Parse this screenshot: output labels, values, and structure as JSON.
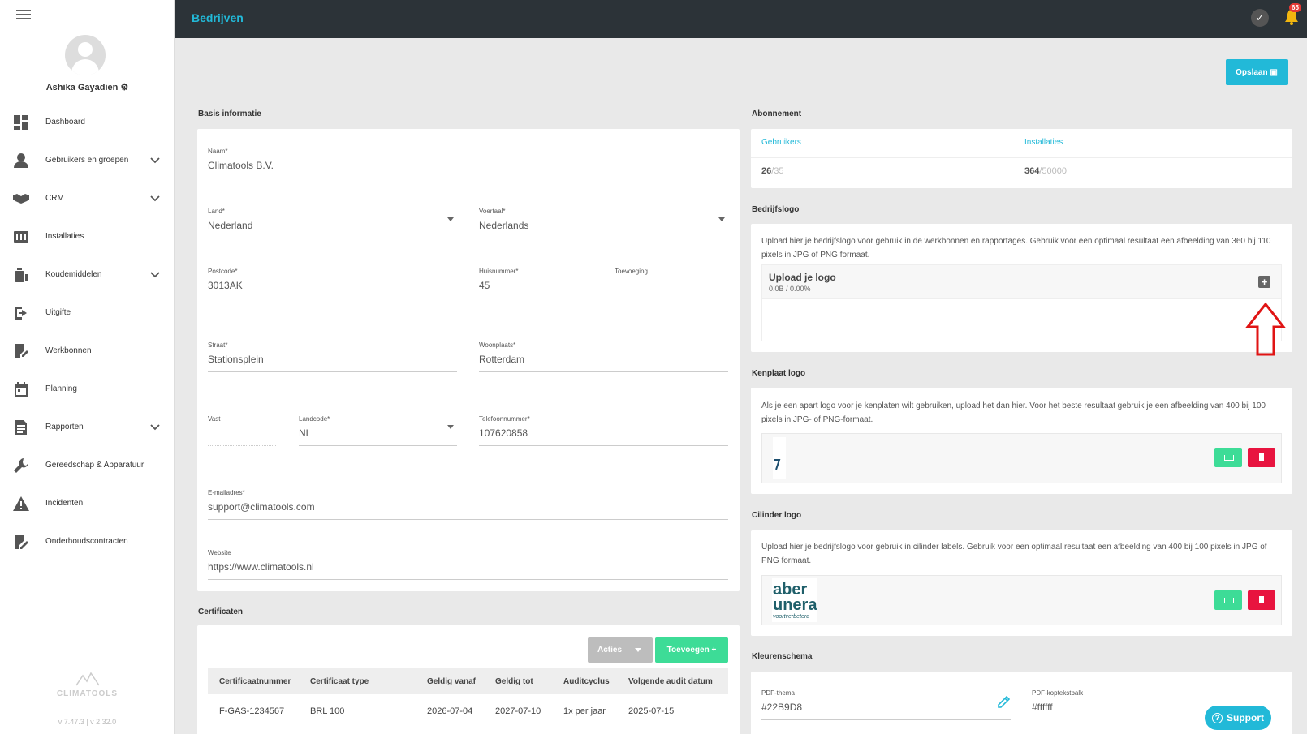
{
  "app": {
    "title": "Bedrijven",
    "notification_count": "65"
  },
  "user": {
    "name": "Ashika Gayadien"
  },
  "sidebar": {
    "items": [
      {
        "label": "Dashboard"
      },
      {
        "label": "Gebruikers en groepen"
      },
      {
        "label": "CRM"
      },
      {
        "label": "Installaties"
      },
      {
        "label": "Koudemiddelen"
      },
      {
        "label": "Uitgifte"
      },
      {
        "label": "Werkbonnen"
      },
      {
        "label": "Planning"
      },
      {
        "label": "Rapporten"
      },
      {
        "label": "Gereedschap & Apparatuur"
      },
      {
        "label": "Incidenten"
      },
      {
        "label": "Onderhoudscontracten"
      }
    ],
    "brand": "CLIMATOOLS",
    "version": "v 7.47.3  | v 2.32.0"
  },
  "toolbar": {
    "save_label": "Opslaan"
  },
  "basis": {
    "title": "Basis informatie",
    "naam_label": "Naam*",
    "naam": "Climatools B.V.",
    "land_label": "Land*",
    "land": "Nederland",
    "voertaal_label": "Voertaal*",
    "voertaal": "Nederlands",
    "postcode_label": "Postcode*",
    "postcode": "3013AK",
    "huisnummer_label": "Huisnummer*",
    "huisnummer": "45",
    "toevoeging_label": "Toevoeging",
    "toevoeging": "",
    "straat_label": "Straat*",
    "straat": "Stationsplein",
    "woonplaats_label": "Woonplaats*",
    "woonplaats": "Rotterdam",
    "vast_label": "Vast",
    "vast": "",
    "landcode_label": "Landcode*",
    "landcode": "NL",
    "telefoon_label": "Telefoonnummer*",
    "telefoon": "107620858",
    "email_label": "E-mailadres*",
    "email": "support@climatools.com",
    "website_label": "Website",
    "website": "https://www.climatools.nl"
  },
  "abonnement": {
    "title": "Abonnement",
    "gebruikers_label": "Gebruikers",
    "gebruikers_used": "26",
    "gebruikers_total": "/35",
    "installaties_label": "Installaties",
    "installaties_used": "364",
    "installaties_total": "/50000"
  },
  "bedrijfslogo": {
    "title": "Bedrijfslogo",
    "desc": "Upload hier je bedrijfslogo voor gebruik in de werkbonnen en rapportages. Gebruik voor een optimaal resultaat een afbeelding van 360 bij 110 pixels in JPG of PNG formaat.",
    "upload_title": "Upload je logo",
    "upload_progress": "0.0B / 0.00%"
  },
  "kenplaat": {
    "title": "Kenplaat logo",
    "desc": "Als je een apart logo voor je kenplaten wilt gebruiken, upload het dan hier. Voor het beste resultaat gebruik je een afbeelding van 400 bij 100 pixels in JPG- of PNG-formaat."
  },
  "cilinder": {
    "title": "Cilinder logo",
    "desc": "Upload hier je bedrijfslogo voor gebruik in cilinder labels. Gebruik voor een optimaal resultaat een afbeelding van 400 bij 100 pixels in JPG of PNG formaat.",
    "logo_line1": "aber",
    "logo_line2": "unera",
    "logo_line3": "voortverbetera"
  },
  "kleuren": {
    "title": "Kleurenschema",
    "pdf_thema_label": "PDF-thema",
    "pdf_thema": "#22B9D8",
    "pdf_kop_label": "PDF-koptekstbalk",
    "pdf_kop": "#ffffff"
  },
  "certificaten": {
    "title": "Certificaten",
    "acties_label": "Acties",
    "toevoegen_label": "Toevoegen +",
    "columns": [
      "Certificaatnummer",
      "Certificaat type",
      "Geldig vanaf",
      "Geldig tot",
      "Auditcyclus",
      "Volgende audit datum"
    ],
    "rows": [
      [
        "F-GAS-1234567",
        "BRL 100",
        "2026-07-04",
        "2027-07-10",
        "1x per jaar",
        "2025-07-15"
      ]
    ]
  },
  "support": {
    "label": "Support"
  },
  "colors": {
    "accent": "#22B9D8",
    "topbar": "#2c3338",
    "green": "#3ddc97",
    "red": "#e8143f"
  }
}
